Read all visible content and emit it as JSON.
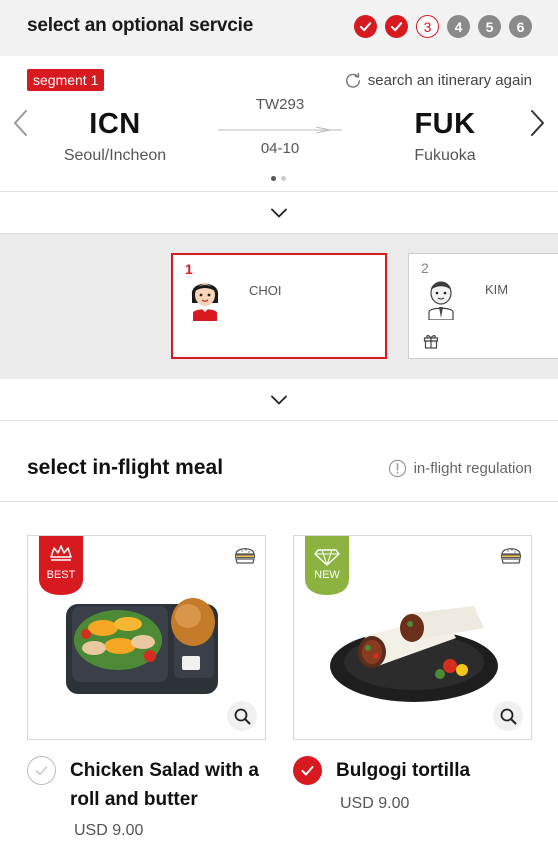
{
  "header": {
    "title": "select an optional servcie",
    "steps": [
      {
        "label": "",
        "state": "done"
      },
      {
        "label": "",
        "state": "done"
      },
      {
        "label": "3",
        "state": "current"
      },
      {
        "label": "4",
        "state": "upcoming"
      },
      {
        "label": "5",
        "state": "upcoming"
      },
      {
        "label": "6",
        "state": "upcoming"
      }
    ]
  },
  "segment": {
    "badge": "segment 1",
    "search_again": "search an itinerary again",
    "flight_no": "TW293",
    "date": "04-10",
    "origin": {
      "code": "ICN",
      "city": "Seoul/Incheon"
    },
    "destination": {
      "code": "FUK",
      "city": "Fukuoka"
    },
    "page_count": 2,
    "current_page": 1
  },
  "passengers": [
    {
      "number": "1",
      "name": "CHOI",
      "selected": true
    },
    {
      "number": "2",
      "name": "KIM",
      "selected": false
    }
  ],
  "meal_section": {
    "title": "select in-flight meal",
    "regulation_link": "in-flight regulation"
  },
  "meals": [
    {
      "badge": "BEST",
      "name": "Chicken Salad with a roll and butter",
      "price": "USD 9.00",
      "selected": false
    },
    {
      "badge": "NEW",
      "name": "Bulgogi tortilla",
      "price": "USD 9.00",
      "selected": true
    }
  ],
  "colors": {
    "accent": "#d71920",
    "new_badge": "#8cb33f",
    "step_upcoming": "#8a8a8a",
    "passenger_area": "#ebebeb"
  }
}
